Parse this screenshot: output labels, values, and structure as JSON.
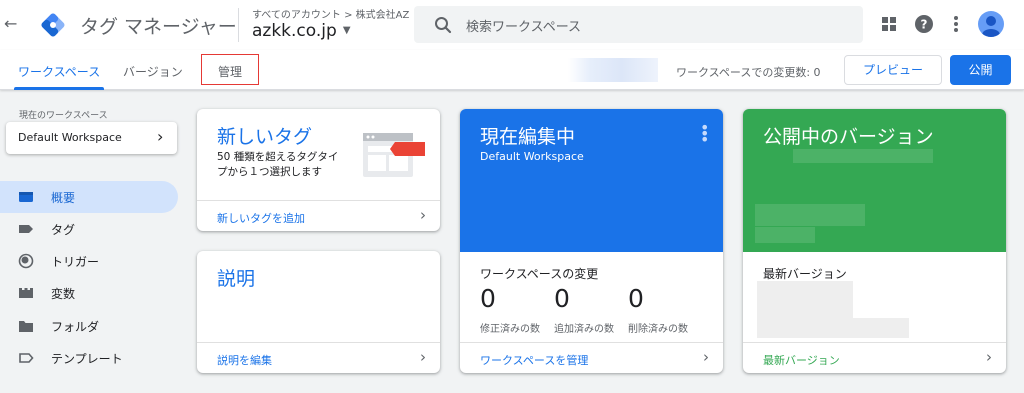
{
  "app": {
    "title": "タグ マネージャー"
  },
  "header": {
    "breadcrumb": "すべてのアカウント > 株式会社AZ",
    "container_name": "azkk.co.jp",
    "search_placeholder": "検索ワークスペース"
  },
  "tabs": [
    {
      "label": "ワークスペース",
      "active": true
    },
    {
      "label": "バージョン",
      "active": false
    },
    {
      "label": "管理",
      "active": false
    }
  ],
  "toolbar": {
    "changes_text": "ワークスペースでの変更数: 0",
    "preview_label": "プレビュー",
    "publish_label": "公開"
  },
  "sidebar": {
    "workspace_label": "現在のワークスペース",
    "workspace_name": "Default Workspace",
    "items": [
      {
        "label": "概要",
        "icon": "overview-icon",
        "active": true
      },
      {
        "label": "タグ",
        "icon": "tag-icon",
        "active": false
      },
      {
        "label": "トリガー",
        "icon": "trigger-icon",
        "active": false
      },
      {
        "label": "変数",
        "icon": "variable-icon",
        "active": false
      },
      {
        "label": "フォルダ",
        "icon": "folder-icon",
        "active": false
      },
      {
        "label": "テンプレート",
        "icon": "template-icon",
        "active": false
      }
    ]
  },
  "cards": {
    "new_tag": {
      "title": "新しいタグ",
      "description": "50 種類を超えるタグタイプから１つ選択します",
      "link": "新しいタグを追加"
    },
    "description": {
      "title": "説明",
      "link": "説明を編集"
    },
    "editing": {
      "title": "現在編集中",
      "workspace": "Default Workspace",
      "section_title": "ワークスペースの変更",
      "stats": [
        {
          "value": "0",
          "label": "修正済みの数"
        },
        {
          "value": "0",
          "label": "追加済みの数"
        },
        {
          "value": "0",
          "label": "削除済みの数"
        }
      ],
      "link": "ワークスペースを管理"
    },
    "published": {
      "title": "公開中のバージョン",
      "section_title": "最新バージョン",
      "link": "最新バージョン"
    }
  },
  "colors": {
    "primary": "#1a73e8",
    "success": "#34a853",
    "accent_red": "#e53935"
  }
}
